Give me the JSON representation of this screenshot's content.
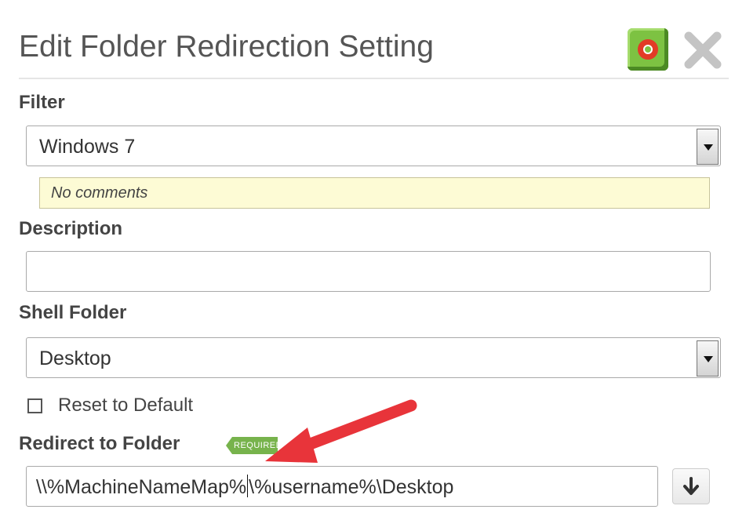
{
  "dialog": {
    "title": "Edit Folder Redirection Setting",
    "help_icon": "lifebuoy-help-icon",
    "close_icon": "close-x-icon"
  },
  "filter": {
    "label": "Filter",
    "selected": "Windows 7",
    "comments": "No comments"
  },
  "description": {
    "label": "Description",
    "value": ""
  },
  "shell_folder": {
    "label": "Shell Folder",
    "selected": "Desktop"
  },
  "reset": {
    "label": "Reset to Default",
    "checked": false
  },
  "redirect": {
    "label": "Redirect to Folder",
    "badge": "REQUIRED",
    "value_before_caret": "\\\\%MachineNameMap%",
    "value_after_caret": "\\%username%\\Desktop",
    "browse_icon": "arrow-down-icon"
  },
  "annotation": {
    "arrow_color": "#e8343a"
  },
  "colors": {
    "badge": "#77b34c",
    "comments_bg": "#fdfbd5",
    "help_green": "#7dc242"
  }
}
